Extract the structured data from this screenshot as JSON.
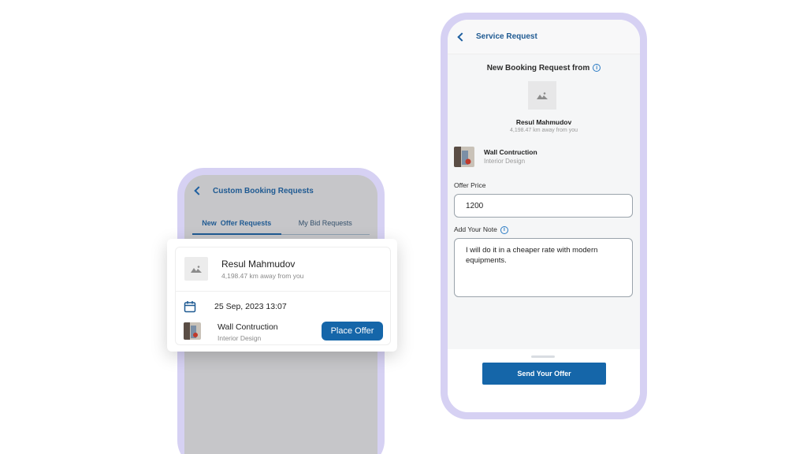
{
  "left_phone": {
    "title": "Custom Booking Requests",
    "tabs": [
      {
        "label": "New  Offer Requests"
      },
      {
        "label": "My Bid Requests"
      }
    ]
  },
  "card": {
    "name": "Resul Mahmudov",
    "distance": "4,198.47 km away from you",
    "date": "25 Sep, 2023 13:07",
    "service": "Wall Contruction",
    "category": "Interior Design",
    "button": "Place Offer"
  },
  "right_phone": {
    "title": "Service Request",
    "heading": "New Booking Request from",
    "name": "Resul Mahmudov",
    "distance": "4,198.47 km away from you",
    "service": "Wall Contruction",
    "category": "Interior Design",
    "offer_price_label": "Offer Price",
    "offer_price_value": "1200",
    "note_label": "Add Your Note",
    "note_value": "I will do it in a cheaper rate with modern equipments.",
    "send_button": "Send Your Offer"
  },
  "colors": {
    "accent": "#1566a9",
    "title_blue": "#1f5a92",
    "phone_frame": "#d6d1f3",
    "overlay_gray": "#c6c6c9"
  },
  "icons": [
    "back-chevron-icon",
    "image-placeholder-icon",
    "calendar-icon",
    "info-icon"
  ]
}
